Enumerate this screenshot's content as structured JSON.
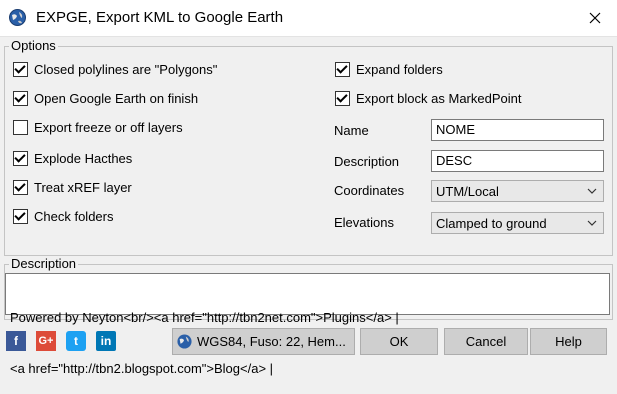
{
  "window": {
    "title": "EXPGE, Export KML to Google Earth"
  },
  "options": {
    "group_label": "Options",
    "left_checks": [
      {
        "label": "Closed polylines are \"Polygons\"",
        "checked": true
      },
      {
        "label": "Open Google Earth on finish",
        "checked": true
      },
      {
        "label": "Export freeze or off layers",
        "checked": false
      },
      {
        "label": "Explode Hacthes",
        "checked": true
      },
      {
        "label": "Treat xREF layer",
        "checked": true
      },
      {
        "label": "Check folders",
        "checked": true
      }
    ],
    "right_checks": [
      {
        "label": "Expand folders",
        "checked": true
      },
      {
        "label": "Export block as MarkedPoint",
        "checked": true
      }
    ],
    "name": {
      "label": "Name",
      "value": "NOME"
    },
    "description_field": {
      "label": "Description",
      "value": "DESC"
    },
    "coordinates": {
      "label": "Coordinates",
      "selected": "UTM/Local"
    },
    "elevations": {
      "label": "Elevations",
      "selected": "Clamped to ground"
    }
  },
  "description": {
    "group_label": "Description",
    "line1": "Powered by Neyton<br/><a href=\"http://tbn2net.com\">Plugins</a> |",
    "line2": "<a href=\"http://tbn2.blogspot.com\">Blog</a> |"
  },
  "footer": {
    "social": [
      {
        "icon": "facebook-icon",
        "glyph": "f",
        "color": "#3b5998"
      },
      {
        "icon": "google-plus-icon",
        "glyph": "G+",
        "color": "#dd4b39"
      },
      {
        "icon": "twitter-icon",
        "glyph": "t",
        "color": "#1da1f2"
      },
      {
        "icon": "linkedin-icon",
        "glyph": "in",
        "color": "#0077b5"
      }
    ],
    "datum_button": "WGS84, Fuso: 22, Hem...",
    "ok_button": "OK",
    "cancel_button": "Cancel",
    "help_button": "Help"
  }
}
